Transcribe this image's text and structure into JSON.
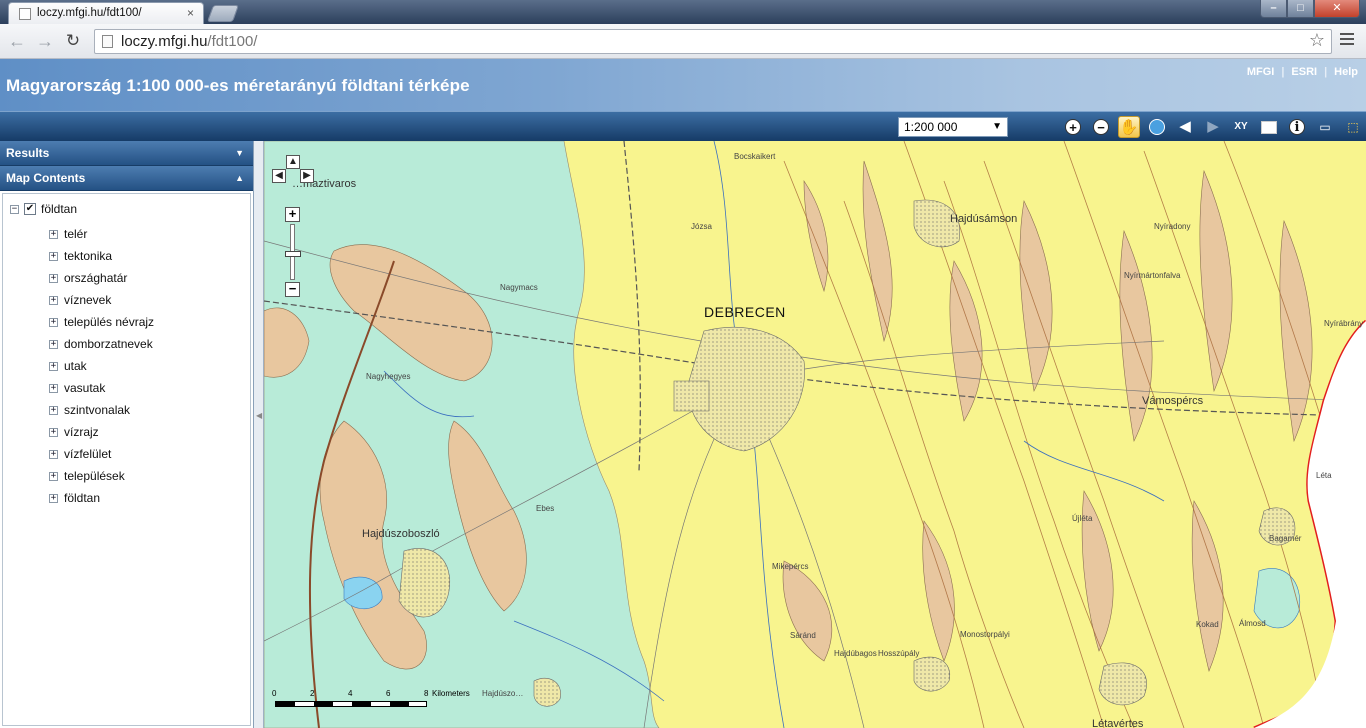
{
  "browser": {
    "tab_title": "loczy.mfgi.hu/fdt100/",
    "tab_close": "×",
    "url_host": "loczy.mfgi.hu",
    "url_path": "/fdt100/",
    "window_controls": {
      "minimize": "–",
      "maximize": "□",
      "close": "✕"
    }
  },
  "header": {
    "title": "Magyarország 1:100 000-es méretarányú földtani térképe",
    "links": [
      "MFGI",
      "ESRI",
      "Help"
    ]
  },
  "toolbar": {
    "scale_value": "1:200 000",
    "tools": [
      "zoom-in-icon",
      "zoom-out-icon",
      "pan-hand-icon",
      "full-extent-globe-icon",
      "previous-extent-icon",
      "next-extent-icon",
      "xy-coordinate-icon",
      "zoom-to-layer-icon",
      "identify-info-icon",
      "measure-ruler-icon",
      "print-export-icon"
    ]
  },
  "panel": {
    "results_label": "Results",
    "contents_label": "Map Contents",
    "root_layer": "földtan",
    "layers": [
      "telér",
      "tektonika",
      "országhatár",
      "víznevek",
      "település névrajz",
      "domborzatnevek",
      "utak",
      "vasutak",
      "szintvonalak",
      "vízrajz",
      "vízfelület",
      "települések",
      "földtan"
    ]
  },
  "map": {
    "labels": {
      "city": "DEBRECEN",
      "town_1": "Hajdúszoboszló",
      "town_2": "Vámospércs",
      "town_3": "Hajdúsámson",
      "town_4": "…maztivaros",
      "small": [
        "Bocskaikert",
        "Józsa",
        "Nagymacs",
        "Nagyhegyes",
        "Ebes",
        "Mikepércs",
        "Sáránd",
        "Hajdúbagos",
        "Hosszúpály",
        "Monostorpályi",
        "Kokad",
        "Álmosd",
        "Bagamér",
        "Újléta",
        "Nyírmártonfalva",
        "Nyírábrány",
        "Hajdúszo…",
        "Léta",
        "Létavértes",
        "Nyíradony"
      ]
    },
    "scalebar": {
      "ticks": [
        "0",
        "2",
        "4",
        "6",
        "8"
      ],
      "unit": "Kilometers"
    },
    "colors": {
      "quaternary_yellow": "#f8f48e",
      "alluvium_teal": "#b8ebd8",
      "loess_tan": "#e8c79f",
      "boundary_red": "#e21e1e"
    }
  }
}
